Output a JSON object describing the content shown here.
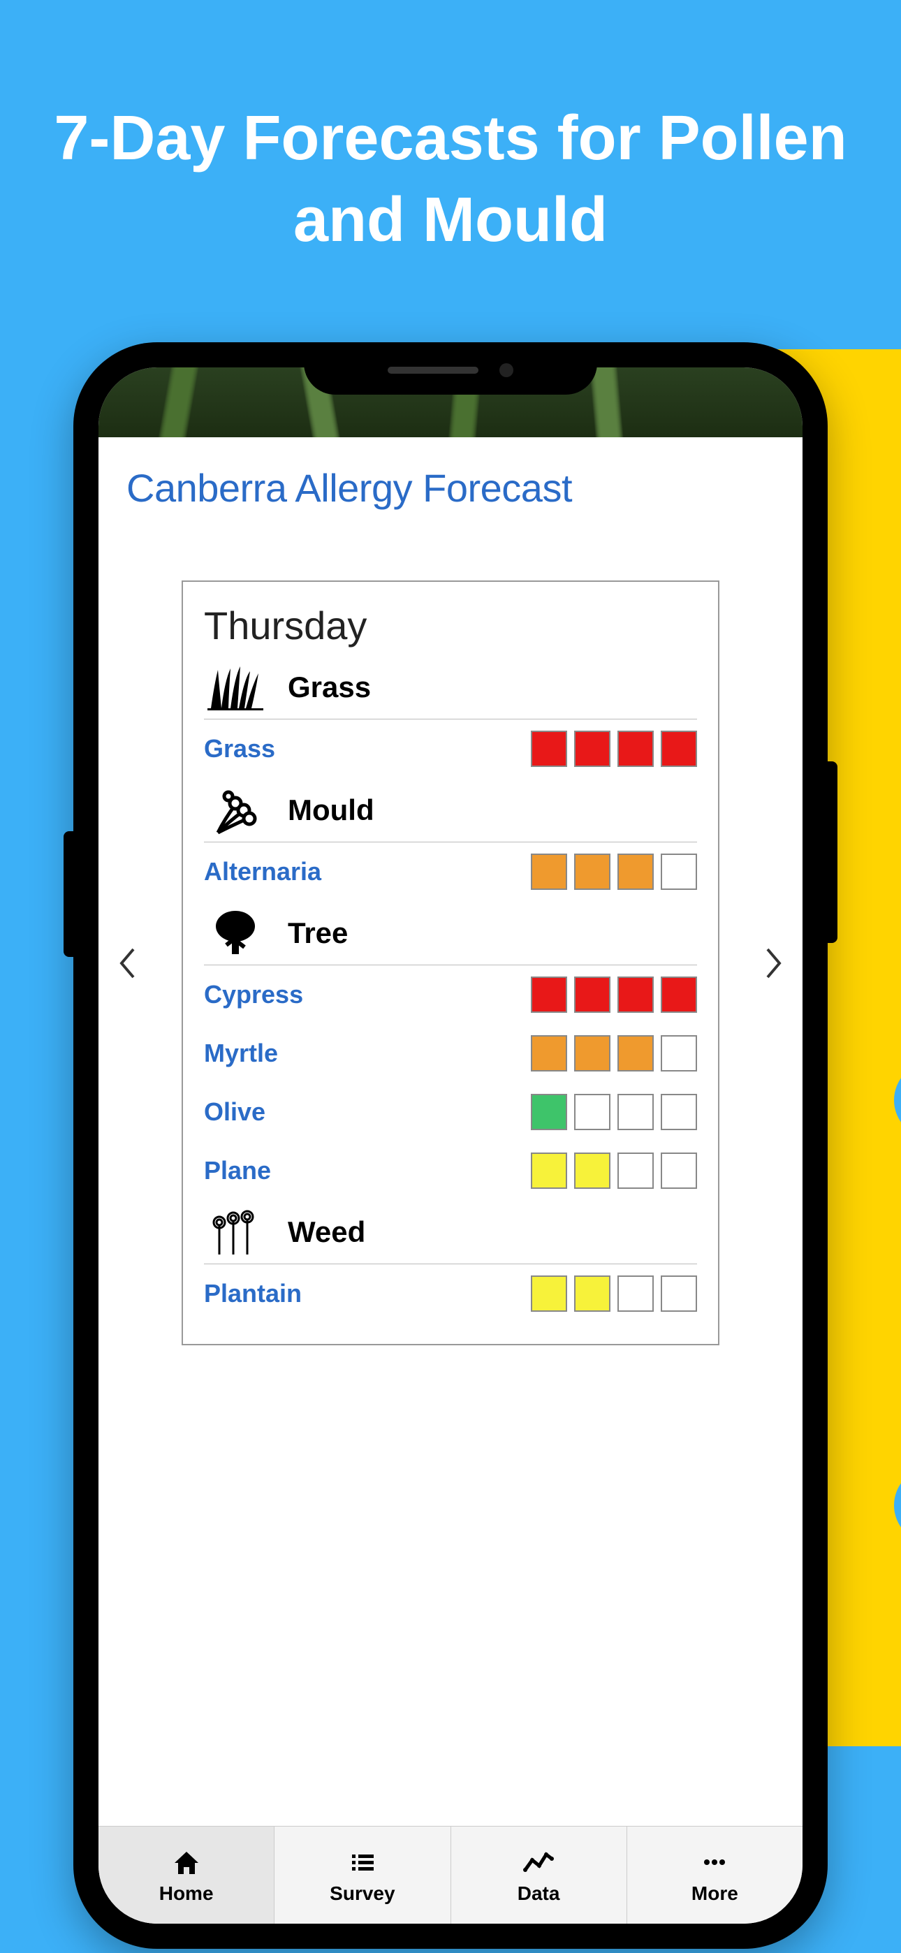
{
  "promo_title": "7-Day Forecasts for Pollen and Mould",
  "page_title": "Canberra Allergy Forecast",
  "day": "Thursday",
  "categories": [
    {
      "icon": "grass-icon",
      "label": "Grass",
      "items": [
        {
          "name": "Grass",
          "level": 4,
          "color": "red"
        }
      ]
    },
    {
      "icon": "mould-icon",
      "label": "Mould",
      "items": [
        {
          "name": "Alternaria",
          "level": 3,
          "color": "orange"
        }
      ]
    },
    {
      "icon": "tree-icon",
      "label": "Tree",
      "items": [
        {
          "name": "Cypress",
          "level": 4,
          "color": "red"
        },
        {
          "name": "Myrtle",
          "level": 3,
          "color": "orange"
        },
        {
          "name": "Olive",
          "level": 1,
          "color": "green"
        },
        {
          "name": "Plane",
          "level": 2,
          "color": "yellow"
        }
      ]
    },
    {
      "icon": "weed-icon",
      "label": "Weed",
      "items": [
        {
          "name": "Plantain",
          "level": 2,
          "color": "yellow"
        }
      ]
    }
  ],
  "tabs": [
    {
      "icon": "home-icon",
      "label": "Home",
      "active": true
    },
    {
      "icon": "list-icon",
      "label": "Survey",
      "active": false
    },
    {
      "icon": "chart-icon",
      "label": "Data",
      "active": false
    },
    {
      "icon": "more-icon",
      "label": "More",
      "active": false
    }
  ]
}
